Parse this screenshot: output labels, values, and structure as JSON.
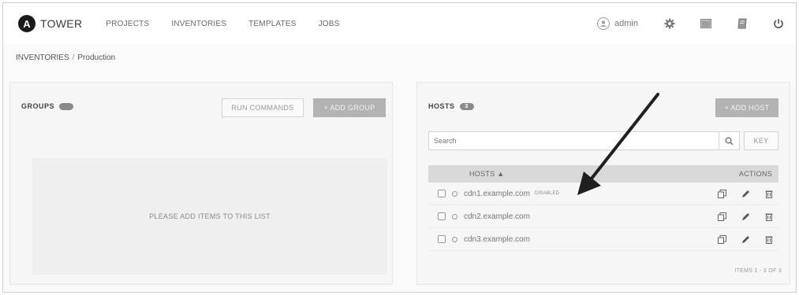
{
  "brand": {
    "logo_letter": "A",
    "name": "TOWER"
  },
  "nav": {
    "links": [
      "PROJECTS",
      "INVENTORIES",
      "TEMPLATES",
      "JOBS"
    ],
    "user": "admin",
    "icons": [
      "settings-icon",
      "activity-icon",
      "docs-icon",
      "power-icon"
    ]
  },
  "breadcrumb": {
    "parent": "INVENTORIES",
    "current": "Production"
  },
  "groups": {
    "title": "GROUPS",
    "count": "",
    "run_commands": "RUN COMMANDS",
    "add_group": "+ ADD GROUP",
    "empty_message": "PLEASE ADD ITEMS TO THIS LIST"
  },
  "hosts": {
    "title": "HOSTS",
    "count": "3",
    "add_host": "+ ADD HOST",
    "search_placeholder": "Search",
    "key_label": "KEY",
    "columns": {
      "name": "HOSTS ▲",
      "actions": "ACTIONS"
    },
    "rows": [
      {
        "name": "cdn1.example.com",
        "tag": "DISABLED"
      },
      {
        "name": "cdn2.example.com",
        "tag": ""
      },
      {
        "name": "cdn3.example.com",
        "tag": ""
      }
    ],
    "pager": "ITEMS 1 - 3 OF 3"
  },
  "colors": {
    "arrow": "#1f1f1f",
    "button_fill": "#b3b3b3",
    "header_bg": "#d9d9d9"
  }
}
